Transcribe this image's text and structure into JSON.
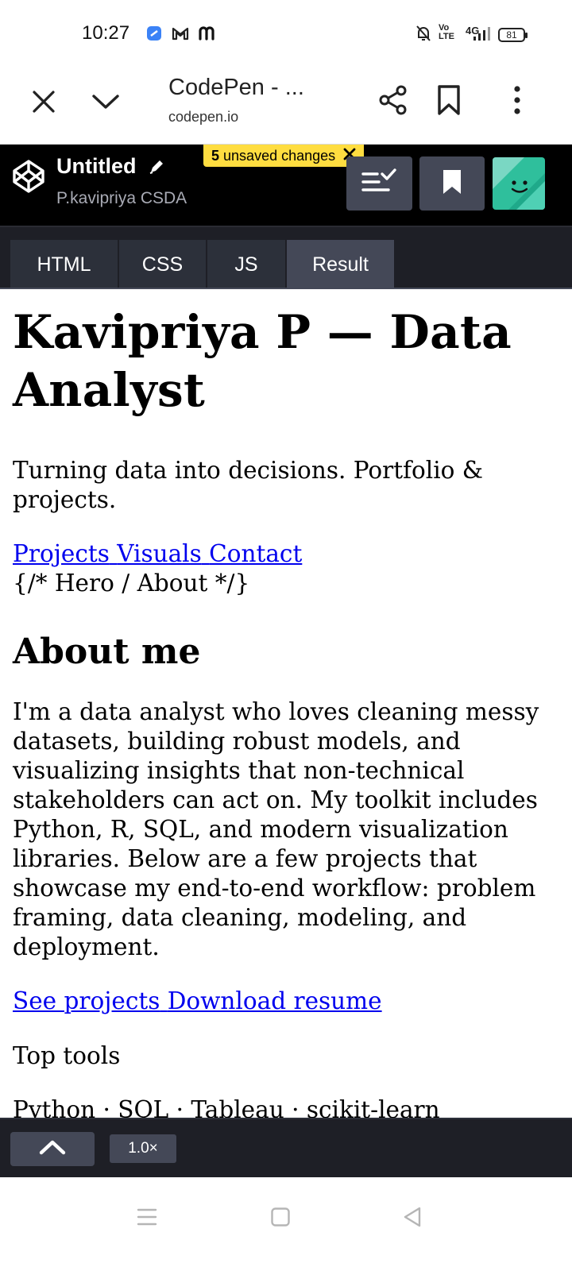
{
  "status": {
    "time": "10:27",
    "volte": "Vo LTE",
    "network": "4G",
    "battery": "81"
  },
  "browser": {
    "title": "CodePen - ...",
    "url": "codepen.io",
    "icons": [
      "close-icon",
      "chevron-down-icon",
      "share-icon",
      "bookmark-icon",
      "more-vertical-icon"
    ]
  },
  "codepen": {
    "pen_title": "Untitled",
    "owner": "P.kavipriya CSDA",
    "unsaved_count": "5",
    "unsaved_label": "unsaved changes",
    "tabs": [
      {
        "label": "HTML"
      },
      {
        "label": "CSS"
      },
      {
        "label": "JS"
      },
      {
        "label": "Result"
      }
    ],
    "active_tab": "Result",
    "zoom": "1.0×"
  },
  "result": {
    "heading": "Kavipriya P — Data Analyst",
    "tagline": "Turning data into decisions. Portfolio & projects.",
    "nav_links": [
      "Projects",
      "Visuals",
      "Contact"
    ],
    "comment": "{/* Hero / About */}",
    "about_heading": "About me",
    "about_text": "I'm a data analyst who loves cleaning messy datasets, building robust models, and visualizing insights that non-technical stakeholders can act on. My toolkit includes Python, R, SQL, and modern visualization libraries. Below are a few projects that showcase my end-to-end workflow: problem framing, data cleaning, modeling, and deployment.",
    "cta_links": [
      "See projects",
      "Download resume"
    ],
    "tools_title": "Top tools",
    "tools_list": "Python · SQL · Tableau · scikit-learn"
  },
  "colors": {
    "codepen_black": "#000000",
    "tab_bg": "#2c303a",
    "tab_active": "#444857",
    "unsaved_yellow": "#ffdd40",
    "link_blue": "#0000ee"
  }
}
